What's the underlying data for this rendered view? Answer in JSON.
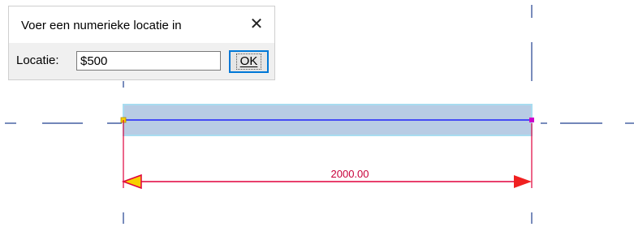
{
  "dialog": {
    "title": "Voer een numerieke locatie in",
    "close_icon": "close-icon",
    "field_label": "Locatie:",
    "input_value": "$500",
    "ok_label": "OK"
  },
  "drawing": {
    "dimension_text": "2000.00",
    "colors": {
      "element_fill": "#b8cce4",
      "element_outline": "#a8dcf0",
      "location_line": "#0000ff",
      "dimension": "#e0003c",
      "reference_line": "#1f3f8f",
      "start_grip": "#f7d000",
      "end_grip": "#cc00cc"
    }
  }
}
